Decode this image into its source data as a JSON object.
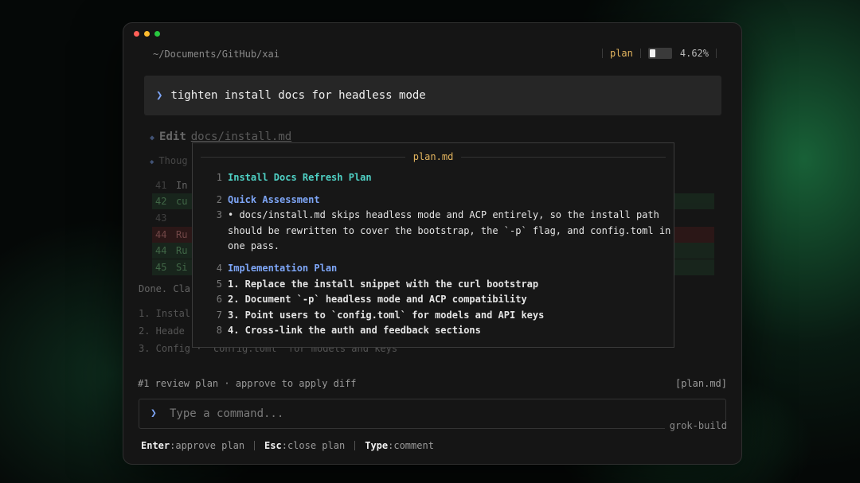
{
  "window": {
    "path": "~/Documents/GitHub/xai",
    "mode": "plan",
    "context_fill": 0.0462,
    "context_percent": "4.62%"
  },
  "prompt": {
    "chevron": "❯",
    "text": "tighten install docs for headless mode"
  },
  "background": {
    "edit_label": "Edit",
    "edit_file": "docs/install.md",
    "thought_label": "Thoug",
    "diff_rows": [
      {
        "ln": "41",
        "code": "In",
        "kind": "plain"
      },
      {
        "ln": "42",
        "code": "cu",
        "kind": "plus"
      },
      {
        "ln": "43",
        "code": "",
        "kind": "plain"
      },
      {
        "ln": "44",
        "code": "Ru",
        "kind": "minus"
      },
      {
        "ln": "44",
        "code": "Ru",
        "kind": "plus"
      },
      {
        "ln": "45",
        "code": "Si",
        "kind": "plus"
      }
    ],
    "done_text": "Done. Cla",
    "summary_list": [
      "1. Instal",
      "2. Heade",
      "3. Config · `config.toml` for models and keys"
    ]
  },
  "plan": {
    "title": "plan.md",
    "lines": [
      {
        "num": "1",
        "text": "Install Docs Refresh Plan",
        "style": "teal"
      },
      {
        "num": "2",
        "text": "Quick Assessment",
        "style": "blue"
      },
      {
        "num": "3",
        "text": "• docs/install.md skips headless mode and ACP entirely, so the install path",
        "style": "plain"
      },
      {
        "num": "",
        "text": "should be rewritten to cover the bootstrap, the `-p` flag, and config.toml in",
        "style": "plain"
      },
      {
        "num": "",
        "text": "one pass.",
        "style": "plain"
      },
      {
        "num": "4",
        "text": "Implementation Plan",
        "style": "blue"
      },
      {
        "num": "5",
        "text": "1. Replace the install snippet with the curl bootstrap",
        "style": "bold"
      },
      {
        "num": "6",
        "text": "2. Document `-p` headless mode and ACP compatibility",
        "style": "bold"
      },
      {
        "num": "7",
        "text": "3. Point users to `config.toml` for models and API keys",
        "style": "bold"
      },
      {
        "num": "8",
        "text": "4. Cross-link the auth and feedback sections",
        "style": "bold"
      }
    ]
  },
  "review": {
    "text": "#1 review plan · approve to apply diff",
    "tag": "[plan.md]"
  },
  "command": {
    "chevron": "❯",
    "placeholder": "Type a command...",
    "value": "",
    "agent": "grok-build"
  },
  "footer": {
    "items": [
      {
        "key": "Enter",
        "action": ":approve plan"
      },
      {
        "key": "Esc",
        "action": ":close plan"
      },
      {
        "key": "Type",
        "action": ":comment"
      }
    ]
  }
}
